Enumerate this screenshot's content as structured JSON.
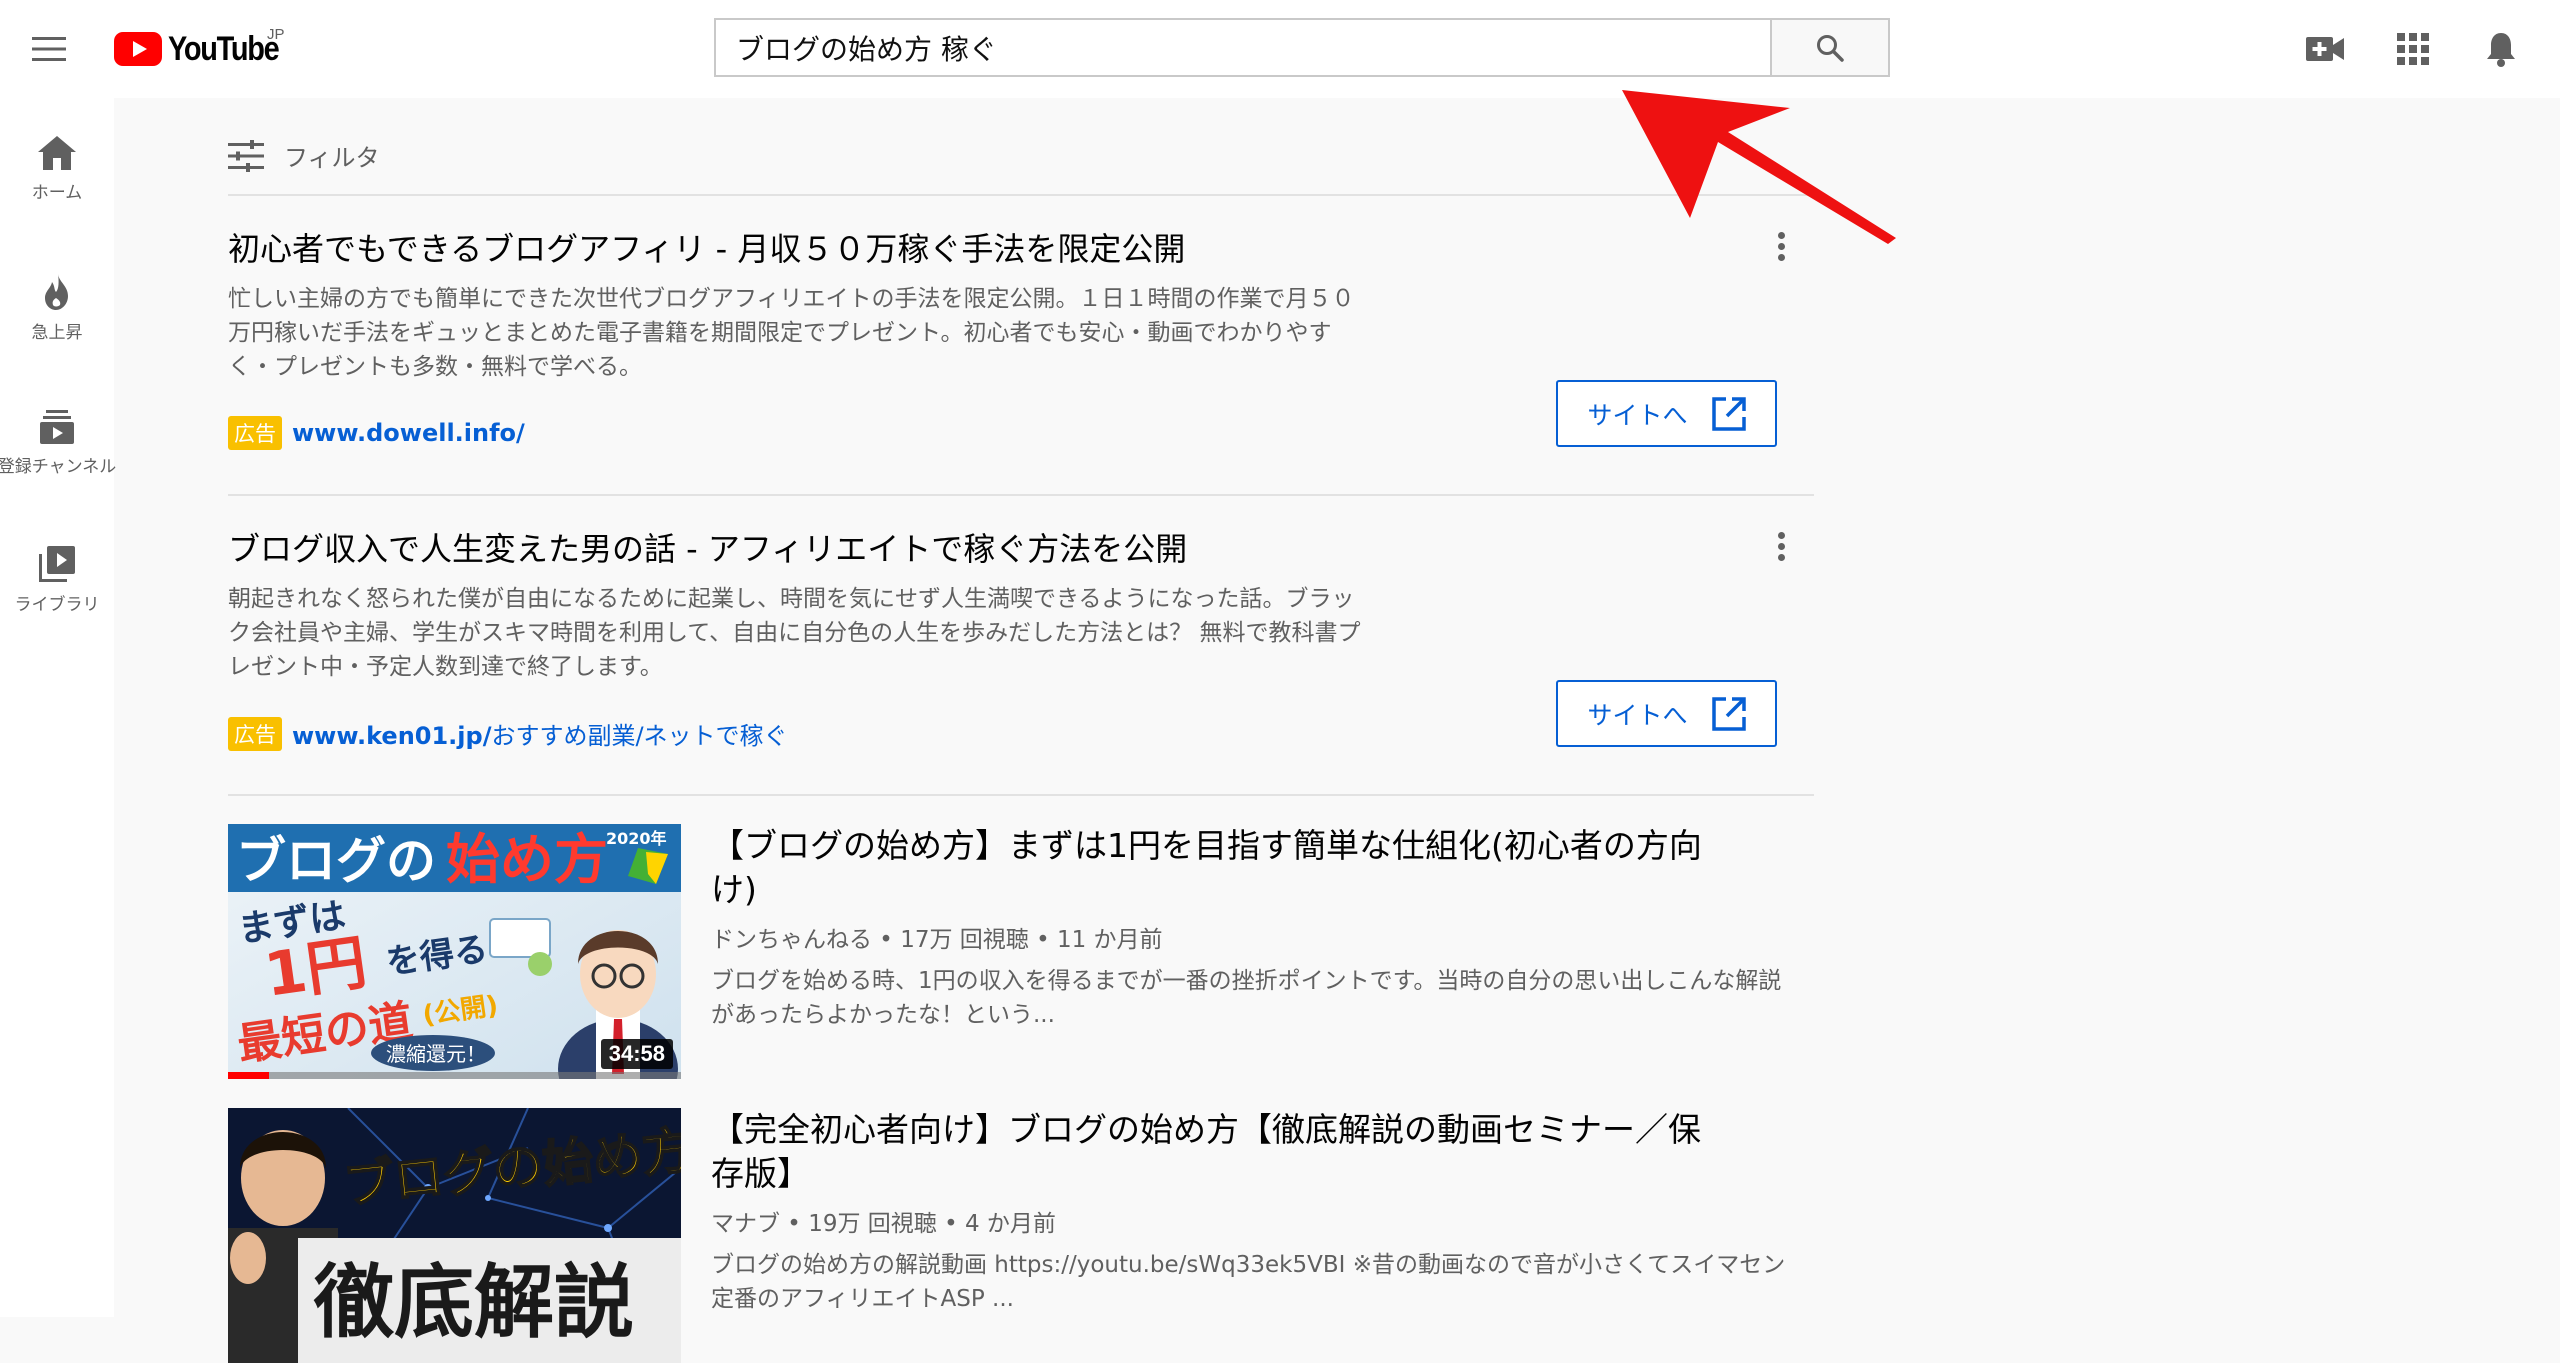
{
  "header": {
    "logo_text": "YouTube",
    "logo_region": "JP",
    "search_query": "ブログの始め方 稼ぐ"
  },
  "sidebar": {
    "items": [
      {
        "label": "ホーム",
        "icon": "home-icon"
      },
      {
        "label": "急上昇",
        "icon": "flame-icon"
      },
      {
        "label": "登録チャンネル",
        "icon": "subscriptions-icon"
      },
      {
        "label": "ライブラリ",
        "icon": "library-icon"
      }
    ]
  },
  "filter": {
    "label": "フィルタ"
  },
  "ads": [
    {
      "title": "初心者でもできるブログアフィリ - 月収５０万稼ぐ手法を限定公開",
      "description": "忙しい主婦の方でも簡単にできた次世代ブログアフィリエイトの手法を限定公開。１日１時間の作業で月５０万円稼いだ手法をギュッとまとめた電子書籍を期間限定でプレゼント。初心者でも安心・動画でわかりやすく・プレゼントも多数・無料で学べる。",
      "badge": "広告",
      "url": "www.dowell.info/",
      "button_label": "サイトへ"
    },
    {
      "title": "ブログ収入で人生変えた男の話 - アフィリエイトで稼ぐ方法を公開",
      "description": "朝起きれなく怒られた僕が自由になるために起業し、時間を気にせず人生満喫できるようになった話。ブラック会社員や主婦、学生がスキマ時間を利用して、自由に自分色の人生を歩みだした方法とは？ 無料で教科書プレゼント中・予定人数到達で終了します。",
      "badge": "広告",
      "url_domain": "www.ken01.jp/",
      "url_path": "おすすめ副業/ネットで稼ぐ",
      "button_label": "サイトへ"
    }
  ],
  "videos": [
    {
      "title": "【ブログの始め方】まずは1円を目指す簡単な仕組化(初心者の方向け)",
      "meta": "ドンちゃんねる • 17万 回視聴 • 11 か月前",
      "description": "ブログを始める時、1円の収入を得るまでが一番の挫折ポイントです。当時の自分の思い出しこんな解説があったらよかったな！という...",
      "duration": "34:58",
      "watched_fraction": 0.09,
      "thumb": {
        "line1a": "ブログの",
        "line1b": "始め方",
        "year": "2020年",
        "line2": "まずは",
        "line3a": "1円",
        "line3b": "を得る",
        "line4": "最短の道",
        "tag": "(公開)",
        "bubble": "濃縮還元！"
      }
    },
    {
      "title": "【完全初心者向け】ブログの始め方【徹底解説の動画セミナー／保存版】",
      "meta": "マナブ • 19万 回視聴 • 4 か月前",
      "description": "ブログの始め方の解説動画 https://youtu.be/sWq33ek5VBI ※昔の動画なので音が小さくてスイマセン 定番のアフィリエイトASP ...",
      "thumb": {
        "line1": "ブログの始め方",
        "line2": "徹底解説"
      }
    }
  ],
  "colors": {
    "brand_red": "#ff0000",
    "link_blue": "#065fd4",
    "ad_badge": "#f9c000",
    "annotation_arrow": "#ee1111"
  }
}
